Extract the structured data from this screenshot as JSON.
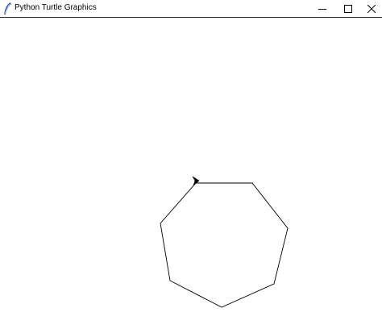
{
  "window": {
    "title": "Python Turtle Graphics",
    "icon": "feather-icon"
  },
  "controls": {
    "minimize_icon": "minimize-icon",
    "maximize_icon": "maximize-icon",
    "close_icon": "close-icon"
  },
  "canvas": {
    "background": "#ffffff",
    "pen_color": "#000000",
    "turtle_color": "#000000",
    "shape": "heptagon",
    "turtle_icon": "turtle-arrow-icon"
  }
}
